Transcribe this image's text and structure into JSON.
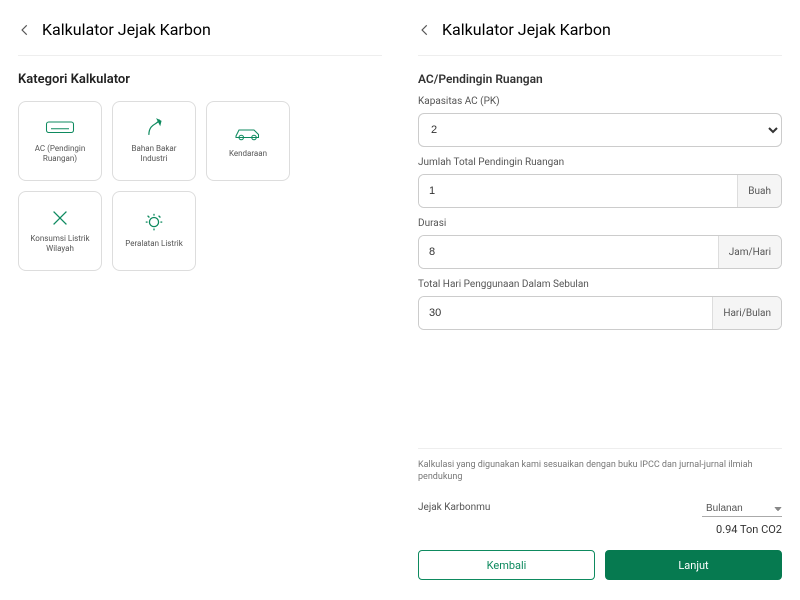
{
  "header": {
    "title": "Kalkulator Jejak Karbon"
  },
  "left": {
    "section_title": "Kategori Kalkulator",
    "cards": [
      {
        "label": "AC (Pendingin Ruangan)"
      },
      {
        "label": "Bahan Bakar Industri"
      },
      {
        "label": "Kendaraan"
      },
      {
        "label": "Konsumsi Listrik Wilayah"
      },
      {
        "label": "Peralatan Listrik"
      }
    ]
  },
  "right": {
    "subtitle": "AC/Pendingin Ruangan",
    "fields": {
      "capacity": {
        "label": "Kapasitas AC (PK)",
        "value": "2"
      },
      "qty": {
        "label": "Jumlah Total Pendingin Ruangan",
        "value": "1",
        "unit": "Buah"
      },
      "duration": {
        "label": "Durasi",
        "value": "8",
        "unit": "Jam/Hari"
      },
      "days": {
        "label": "Total Hari Penggunaan Dalam Sebulan",
        "value": "30",
        "unit": "Hari/Bulan"
      }
    },
    "note": "Kalkulasi yang digunakan kami sesuaikan dengan buku IPCC dan jurnal-jurnal ilmiah pendukung",
    "result": {
      "label": "Jejak Karbonmu",
      "period": "Bulanan",
      "value": "0.94 Ton CO2"
    },
    "buttons": {
      "back": "Kembali",
      "next": "Lanjut"
    }
  }
}
